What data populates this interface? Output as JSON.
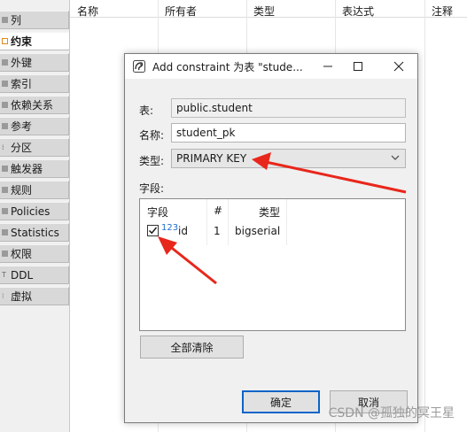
{
  "sidebar": {
    "items": [
      {
        "label": "列",
        "icon": "column-icon"
      },
      {
        "label": "约束",
        "icon": "constraint-icon",
        "active": true
      },
      {
        "label": "外键",
        "icon": "foreign-key-icon"
      },
      {
        "label": "索引",
        "icon": "index-icon"
      },
      {
        "label": "依赖关系",
        "icon": "dependency-icon"
      },
      {
        "label": "参考",
        "icon": "reference-icon"
      },
      {
        "label": "分区",
        "icon": "partition-icon"
      },
      {
        "label": "触发器",
        "icon": "trigger-icon"
      },
      {
        "label": "规则",
        "icon": "rule-icon"
      },
      {
        "label": "Policies",
        "icon": "policy-icon"
      },
      {
        "label": "Statistics",
        "icon": "statistics-icon"
      },
      {
        "label": "权限",
        "icon": "permission-icon"
      },
      {
        "label": "DDL",
        "icon": "ddl-icon"
      },
      {
        "label": "虚拟",
        "icon": "virtual-icon"
      }
    ]
  },
  "grid": {
    "columns": [
      "名称",
      "所有者",
      "类型",
      "表达式",
      "注释"
    ]
  },
  "dialog": {
    "title": "Add constraint 为表 \"stude...",
    "table_label": "表:",
    "table_value": "public.student",
    "name_label": "名称:",
    "name_value": "student_pk",
    "type_label": "类型:",
    "type_value": "PRIMARY KEY",
    "fields_label": "字段:",
    "fields_table": {
      "headers": [
        "字段",
        "#",
        "类型"
      ],
      "rows": [
        {
          "checked": true,
          "icon_text": "123",
          "name": "id",
          "index": "1",
          "type": "bigserial"
        }
      ]
    },
    "clear_all_label": "全部清除",
    "ok_label": "确定",
    "cancel_label": "取消"
  },
  "watermark": "CSDN @孤独的冥王星",
  "colors": {
    "accent": "#0a64c8",
    "arrow": "#e8271b",
    "sidebar_bg": "#d8d8d8"
  }
}
